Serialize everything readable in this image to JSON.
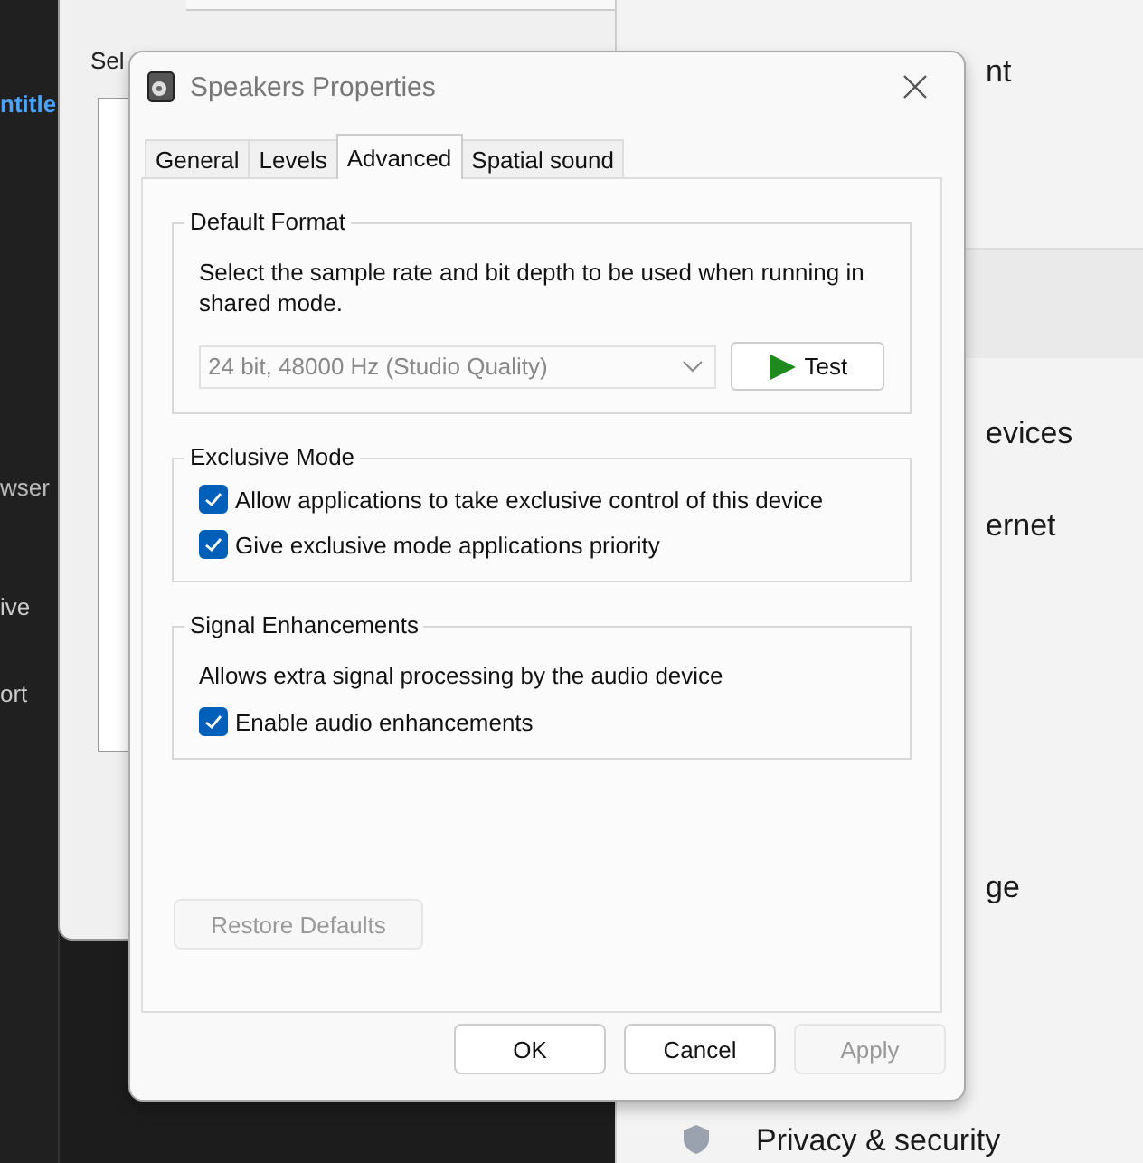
{
  "background": {
    "left_texts": [
      "ntitle",
      "wser",
      "ive",
      "ort"
    ],
    "sound_window": {
      "prompt": "Sel"
    },
    "settings_items": [
      {
        "label": "nt"
      },
      {
        "label": "evices"
      },
      {
        "label": "ernet"
      },
      {
        "label": "ge"
      },
      {
        "label": "Privacy & security"
      }
    ]
  },
  "window": {
    "title": "Speakers Properties"
  },
  "tabs": [
    {
      "label": "General",
      "selected": false
    },
    {
      "label": "Levels",
      "selected": false
    },
    {
      "label": "Advanced",
      "selected": true
    },
    {
      "label": "Spatial sound",
      "selected": false
    }
  ],
  "groups": [
    {
      "title": "Default Format",
      "description": "Select the sample rate and bit depth to be used when running in shared mode.",
      "format_select": {
        "value": "24 bit, 48000 Hz (Studio Quality)",
        "disabled": true
      },
      "test_button": "Test"
    },
    {
      "title": "Exclusive Mode",
      "checkboxes": [
        {
          "label": "Allow applications to take exclusive control of this device",
          "checked": true
        },
        {
          "label": "Give exclusive mode applications priority",
          "checked": true
        }
      ]
    },
    {
      "title": "Signal Enhancements",
      "description": "Allows extra signal processing by the audio device",
      "checkboxes": [
        {
          "label": "Enable audio enhancements",
          "checked": true
        }
      ]
    }
  ],
  "restore_defaults": {
    "label": "Restore Defaults",
    "disabled": true
  },
  "buttons": [
    {
      "label": "OK",
      "disabled": false
    },
    {
      "label": "Cancel",
      "disabled": false
    },
    {
      "label": "Apply",
      "disabled": true
    }
  ]
}
